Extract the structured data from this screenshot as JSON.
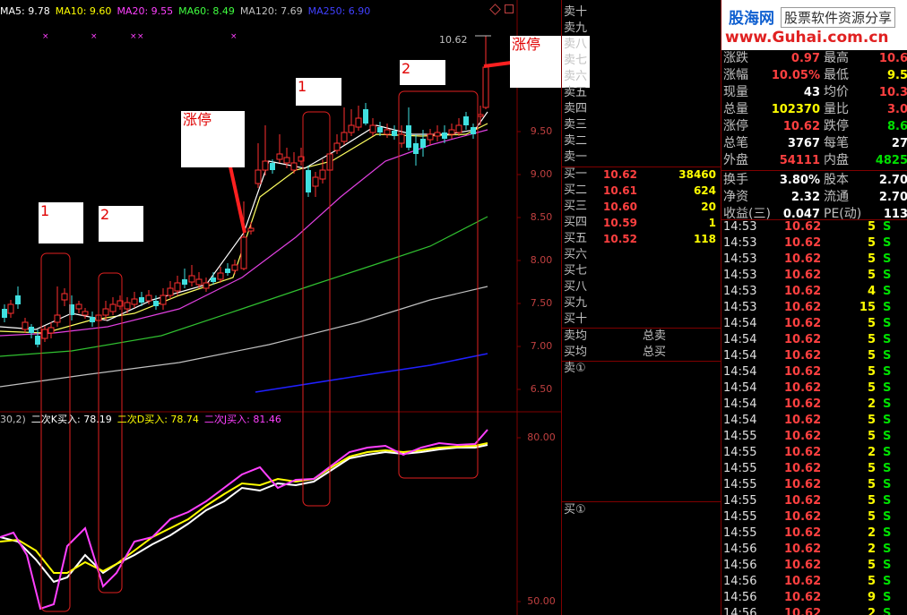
{
  "ma_legend": [
    {
      "text": "MA5: 9.78",
      "color": "#ffffff"
    },
    {
      "text": "MA10: 9.60",
      "color": "#ffff00"
    },
    {
      "text": "MA20: 9.55",
      "color": "#ff40ff"
    },
    {
      "text": "MA60: 8.49",
      "color": "#40ff40"
    },
    {
      "text": "MA120: 7.69",
      "color": "#c0c0c0"
    },
    {
      "text": "MA250: 6.90",
      "color": "#4040ff"
    }
  ],
  "kdj_legend": [
    {
      "text": "30,2)",
      "color": "#c0c0c0"
    },
    {
      "text": "二次K买入: 78.19",
      "color": "#ffffff"
    },
    {
      "text": "二次D买入: 78.74",
      "color": "#ffff00"
    },
    {
      "text": "二次J买入: 81.46",
      "color": "#ff40ff"
    }
  ],
  "price_axis": [
    "9.50",
    "9.00",
    "8.50",
    "8.00",
    "7.50",
    "7.00",
    "6.50"
  ],
  "kdj_axis": [
    "80.00",
    "50.00"
  ],
  "peak_label": "10.62",
  "annotations": {
    "box1_left": "1",
    "box2_left": "2",
    "zt_left": "涨停",
    "box1_mid": "1",
    "box2_right": "2",
    "zt_right": "涨停"
  },
  "orderbook": {
    "sell_labels": [
      "卖十",
      "卖九",
      "卖八",
      "卖七",
      "卖六",
      "卖五",
      "卖四",
      "卖三",
      "卖二",
      "卖一"
    ],
    "buy": [
      {
        "label": "买一",
        "price": "10.62",
        "vol": "38460"
      },
      {
        "label": "买二",
        "price": "10.61",
        "vol": "624"
      },
      {
        "label": "买三",
        "price": "10.60",
        "vol": "20"
      },
      {
        "label": "买四",
        "price": "10.59",
        "vol": "1"
      },
      {
        "label": "买五",
        "price": "10.52",
        "vol": "118"
      },
      {
        "label": "买六",
        "price": "",
        "vol": ""
      },
      {
        "label": "买七",
        "price": "",
        "vol": ""
      },
      {
        "label": "买八",
        "price": "",
        "vol": ""
      },
      {
        "label": "买九",
        "price": "",
        "vol": ""
      },
      {
        "label": "买十",
        "price": "",
        "vol": ""
      }
    ],
    "avg_sell_label": "卖均",
    "total_sell_label": "总卖",
    "avg_buy_label": "买均",
    "total_buy_label": "总买",
    "sell_queue_label": "卖①",
    "buy_queue_label": "买①"
  },
  "logo": {
    "name": "股海网",
    "slogan": "股票软件资源分享",
    "url": "www.Guhai.com.cn"
  },
  "quote": [
    {
      "k1": "涨跌",
      "v1": "0.97",
      "c1": "#ff4040",
      "k2": "最高",
      "v2": "10.6",
      "c2": "#ff4040"
    },
    {
      "k1": "涨幅",
      "v1": "10.05%",
      "c1": "#ff4040",
      "k2": "最低",
      "v2": "9.5",
      "c2": "#ffff00"
    },
    {
      "k1": "现量",
      "v1": "43",
      "c1": "#ffffff",
      "k2": "均价",
      "v2": "10.3",
      "c2": "#ff4040"
    },
    {
      "k1": "总量",
      "v1": "102370",
      "c1": "#ffff00",
      "k2": "量比",
      "v2": "3.0",
      "c2": "#ff4040"
    },
    {
      "k1": "涨停",
      "v1": "10.62",
      "c1": "#ff4040",
      "k2": "跌停",
      "v2": "8.6",
      "c2": "#00e000"
    },
    {
      "k1": "总笔",
      "v1": "3767",
      "c1": "#ffffff",
      "k2": "每笔",
      "v2": "27",
      "c2": "#ffffff"
    },
    {
      "k1": "外盘",
      "v1": "54111",
      "c1": "#ff4040",
      "k2": "内盘",
      "v2": "4825",
      "c2": "#00e000"
    },
    {
      "k1": "换手",
      "v1": "3.80%",
      "c1": "#ffffff",
      "k2": "股本",
      "v2": "2.70",
      "c2": "#ffffff"
    },
    {
      "k1": "净资",
      "v1": "2.32",
      "c1": "#ffffff",
      "k2": "流通",
      "v2": "2.70",
      "c2": "#ffffff"
    },
    {
      "k1": "收益(三)",
      "v1": "0.047",
      "c1": "#ffffff",
      "k2": "PE(动)",
      "v2": "113",
      "c2": "#ffffff"
    }
  ],
  "ticks": [
    {
      "time": "14:53",
      "price": "10.62",
      "vol": "5",
      "side": "S"
    },
    {
      "time": "14:53",
      "price": "10.62",
      "vol": "5",
      "side": "S"
    },
    {
      "time": "14:53",
      "price": "10.62",
      "vol": "5",
      "side": "S"
    },
    {
      "time": "14:53",
      "price": "10.62",
      "vol": "5",
      "side": "S"
    },
    {
      "time": "14:53",
      "price": "10.62",
      "vol": "4",
      "side": "S"
    },
    {
      "time": "14:53",
      "price": "10.62",
      "vol": "15",
      "side": "S"
    },
    {
      "time": "14:54",
      "price": "10.62",
      "vol": "5",
      "side": "S"
    },
    {
      "time": "14:54",
      "price": "10.62",
      "vol": "5",
      "side": "S"
    },
    {
      "time": "14:54",
      "price": "10.62",
      "vol": "5",
      "side": "S"
    },
    {
      "time": "14:54",
      "price": "10.62",
      "vol": "5",
      "side": "S"
    },
    {
      "time": "14:54",
      "price": "10.62",
      "vol": "5",
      "side": "S"
    },
    {
      "time": "14:54",
      "price": "10.62",
      "vol": "2",
      "side": "S"
    },
    {
      "time": "14:54",
      "price": "10.62",
      "vol": "5",
      "side": "S"
    },
    {
      "time": "14:55",
      "price": "10.62",
      "vol": "5",
      "side": "S"
    },
    {
      "time": "14:55",
      "price": "10.62",
      "vol": "2",
      "side": "S"
    },
    {
      "time": "14:55",
      "price": "10.62",
      "vol": "5",
      "side": "S"
    },
    {
      "time": "14:55",
      "price": "10.62",
      "vol": "5",
      "side": "S"
    },
    {
      "time": "14:55",
      "price": "10.62",
      "vol": "5",
      "side": "S"
    },
    {
      "time": "14:55",
      "price": "10.62",
      "vol": "5",
      "side": "S"
    },
    {
      "time": "14:55",
      "price": "10.62",
      "vol": "2",
      "side": "S"
    },
    {
      "time": "14:56",
      "price": "10.62",
      "vol": "2",
      "side": "S"
    },
    {
      "time": "14:56",
      "price": "10.62",
      "vol": "5",
      "side": "S"
    },
    {
      "time": "14:56",
      "price": "10.62",
      "vol": "5",
      "side": "S"
    },
    {
      "time": "14:56",
      "price": "10.62",
      "vol": "9",
      "side": "S"
    },
    {
      "time": "14:56",
      "price": "10.62",
      "vol": "2",
      "side": "S"
    }
  ],
  "colors": {
    "up": "#ff3030",
    "down": "#40e0e0",
    "frame": "#800000"
  }
}
